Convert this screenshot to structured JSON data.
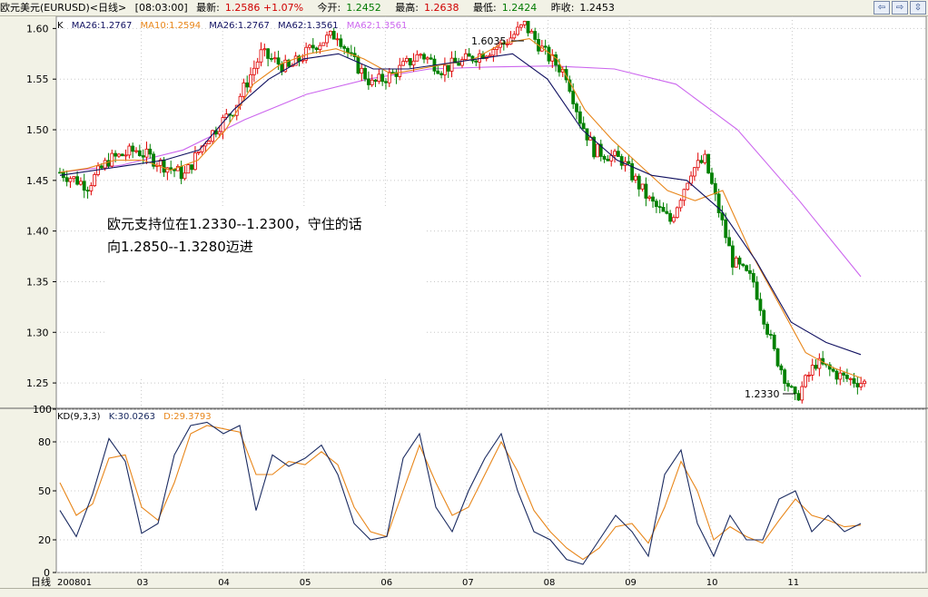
{
  "header": {
    "symbol": "欧元美元(EURUSD)<日线>",
    "time": "[08:03:00]",
    "latest_label": "最新:",
    "latest_value": "1.2586 +1.07%",
    "open_label": "今开:",
    "open_value": "1.2452",
    "high_label": "最高:",
    "high_value": "1.2638",
    "low_label": "最低:",
    "low_value": "1.2424",
    "prev_label": "昨收:",
    "prev_value": "1.2453"
  },
  "window_buttons": [
    "⇦",
    "⇨",
    "⇳"
  ],
  "main_legend": {
    "k_label": "K",
    "ma26a": "MA26:1.2767",
    "ma10": "MA10:1.2594",
    "ma26b": "MA26:1.2767",
    "ma62a": "MA62:1.3561",
    "ma62b": "MA62:1.3561"
  },
  "kd_legend": {
    "name": "KD(9,3,3)",
    "k": "K:30.0263",
    "d": "D:29.3793"
  },
  "annotation": {
    "line1": "欧元支持位在1.2330--1.2300，守住的话",
    "line2": "向1.2850--1.3280迈进"
  },
  "status_bar": "",
  "colors": {
    "background": "#ffffff",
    "up": "#e00000",
    "down": "#008000",
    "ma10": "#e8861a",
    "ma26": "#101060",
    "ma62": "#cc66ee",
    "kd_k": "#1a2a60",
    "kd_d": "#e8861a"
  },
  "chart_data": [
    {
      "type": "candlestick",
      "title": "欧元美元(EURUSD) 日线",
      "x_ticks": [
        "200801",
        "03",
        "04",
        "05",
        "06",
        "07",
        "08",
        "09",
        "10",
        "11"
      ],
      "y_ticks": [
        "1.60",
        "1.55",
        "1.50",
        "1.45",
        "1.40",
        "1.35",
        "1.30",
        "1.25"
      ],
      "ylim": [
        1.225,
        1.612
      ],
      "annotations": [
        {
          "text": "1.6035",
          "value": 1.6035
        },
        {
          "text": "1.2330",
          "value": 1.233
        }
      ],
      "price_path": [
        [
          0,
          1.458
        ],
        [
          8,
          1.445
        ],
        [
          14,
          1.47
        ],
        [
          22,
          1.48
        ],
        [
          30,
          1.465
        ],
        [
          36,
          1.455
        ],
        [
          42,
          1.49
        ],
        [
          50,
          1.52
        ],
        [
          58,
          1.575
        ],
        [
          66,
          1.56
        ],
        [
          74,
          1.585
        ],
        [
          80,
          1.595
        ],
        [
          84,
          1.57
        ],
        [
          90,
          1.545
        ],
        [
          96,
          1.555
        ],
        [
          104,
          1.575
        ],
        [
          110,
          1.56
        ],
        [
          118,
          1.57
        ],
        [
          128,
          1.585
        ],
        [
          134,
          1.6035
        ],
        [
          140,
          1.575
        ],
        [
          146,
          1.555
        ],
        [
          150,
          1.51
        ],
        [
          154,
          1.48
        ],
        [
          162,
          1.47
        ],
        [
          170,
          1.43
        ],
        [
          176,
          1.41
        ],
        [
          182,
          1.46
        ],
        [
          186,
          1.47
        ],
        [
          194,
          1.37
        ],
        [
          200,
          1.35
        ],
        [
          206,
          1.28
        ],
        [
          212,
          1.233
        ],
        [
          218,
          1.27
        ],
        [
          226,
          1.255
        ],
        [
          232,
          1.25
        ]
      ],
      "series": [
        {
          "name": "MA10",
          "values": [
            1.458,
            1.462,
            1.47,
            1.47,
            1.46,
            1.47,
            1.5,
            1.545,
            1.565,
            1.575,
            1.58,
            1.57,
            1.555,
            1.56,
            1.565,
            1.57,
            1.585,
            1.59,
            1.57,
            1.52,
            1.49,
            1.465,
            1.44,
            1.43,
            1.44,
            1.38,
            1.33,
            1.28,
            1.265,
            1.255
          ]
        },
        {
          "name": "MA26",
          "values": [
            1.455,
            1.46,
            1.465,
            1.47,
            1.48,
            1.52,
            1.55,
            1.57,
            1.575,
            1.56,
            1.56,
            1.565,
            1.57,
            1.575,
            1.55,
            1.5,
            1.47,
            1.455,
            1.45,
            1.42,
            1.37,
            1.31,
            1.29,
            1.278
          ]
        },
        {
          "name": "MA62",
          "values": [
            1.458,
            1.465,
            1.48,
            1.51,
            1.535,
            1.55,
            1.56,
            1.562,
            1.563,
            1.56,
            1.545,
            1.5,
            1.43,
            1.355
          ]
        }
      ]
    },
    {
      "type": "line",
      "title": "KD(9,3,3)",
      "y_ticks": [
        "100",
        "80",
        "50",
        "20",
        "0"
      ],
      "ylim": [
        0,
        100
      ],
      "series": [
        {
          "name": "K",
          "values": [
            38,
            22,
            48,
            82,
            68,
            24,
            30,
            72,
            90,
            92,
            85,
            90,
            38,
            72,
            65,
            70,
            78,
            60,
            30,
            20,
            22,
            70,
            85,
            40,
            25,
            50,
            70,
            85,
            50,
            25,
            20,
            8,
            5,
            20,
            35,
            25,
            10,
            60,
            75,
            30,
            10,
            35,
            20,
            20,
            45,
            50,
            25,
            35,
            25,
            30
          ]
        },
        {
          "name": "D",
          "values": [
            55,
            35,
            42,
            70,
            72,
            40,
            32,
            55,
            85,
            90,
            88,
            86,
            60,
            60,
            68,
            66,
            74,
            66,
            40,
            25,
            22,
            50,
            78,
            55,
            35,
            40,
            60,
            80,
            62,
            38,
            25,
            15,
            8,
            15,
            28,
            30,
            18,
            40,
            68,
            50,
            20,
            28,
            22,
            18,
            32,
            45,
            35,
            32,
            28,
            29
          ]
        }
      ]
    }
  ]
}
